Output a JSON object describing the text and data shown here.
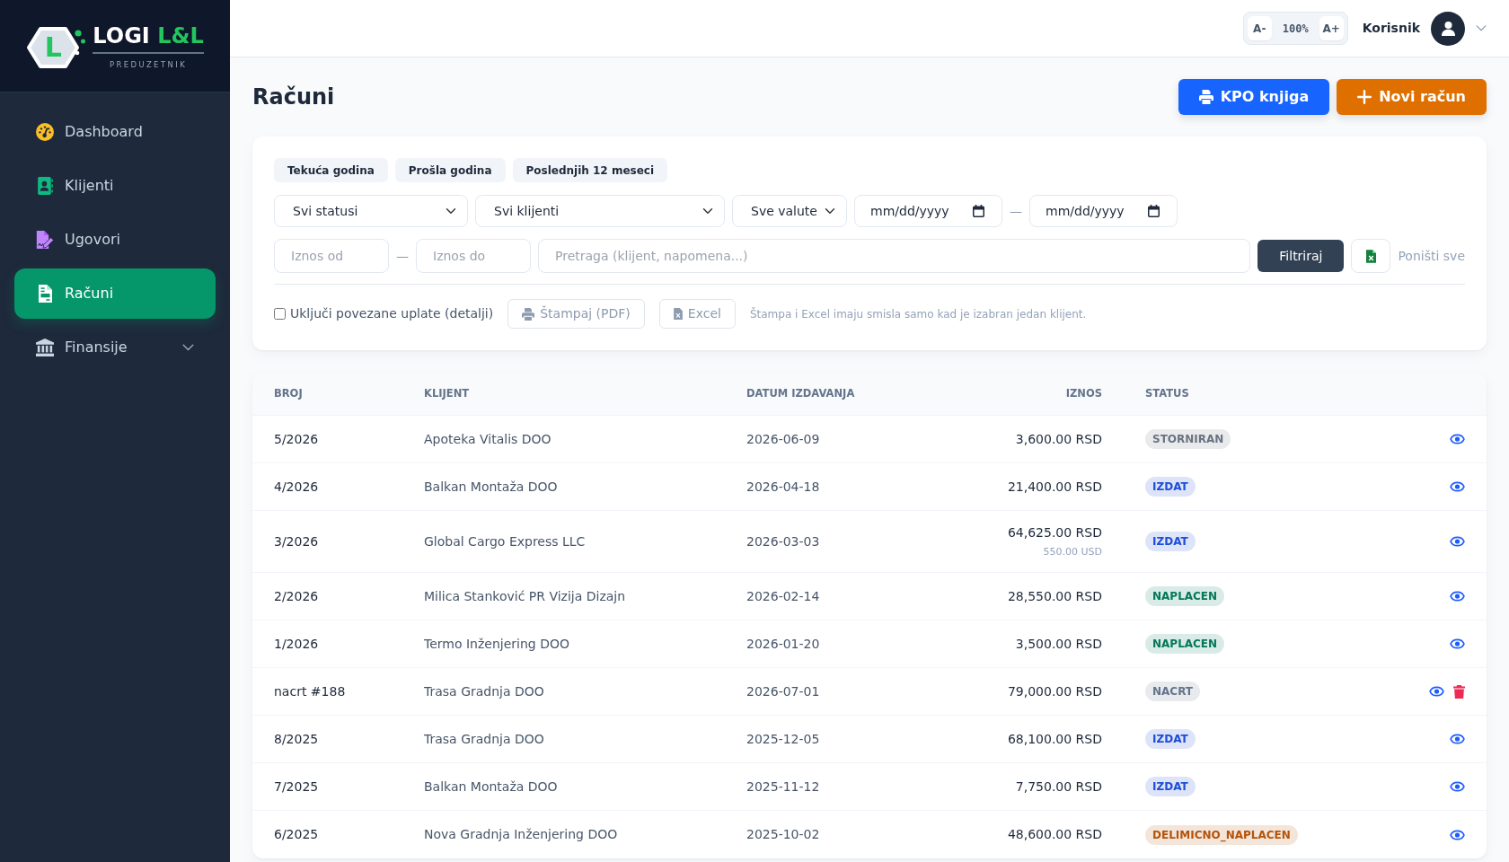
{
  "sidebar": {
    "logo": {
      "mark": "L",
      "title": "LOGI",
      "title_accent": "L&L",
      "tagline": "PREDUZETNIK"
    },
    "items": [
      {
        "label": "Dashboard",
        "kind": "link",
        "selected": false
      },
      {
        "label": "Klijenti",
        "kind": "link",
        "selected": false
      },
      {
        "label": "Ugovori",
        "kind": "link",
        "selected": false
      },
      {
        "label": "Računi",
        "kind": "link",
        "selected": true
      },
      {
        "label": "Finansije",
        "kind": "group",
        "selected": false
      }
    ]
  },
  "topbar": {
    "font_decrease": "A-",
    "zoom_level": "100%",
    "font_increase": "A+",
    "user_name": "Korisnik"
  },
  "page": {
    "title": "Računi",
    "actions": [
      {
        "label": "KPO knjiga",
        "kind": "print"
      },
      {
        "label": "Novi račun",
        "kind": "create"
      }
    ]
  },
  "filters": {
    "quick_ranges": [
      "Tekuća godina",
      "Prošla godina",
      "Poslednjih 12 meseci"
    ],
    "status": {
      "value": "Svi statusi"
    },
    "client": {
      "value": "Svi klijenti"
    },
    "currency": {
      "value": "Sve valute"
    },
    "date_from": {
      "placeholder": "mm/dd/yyyy"
    },
    "date_separator": "—",
    "date_to": {
      "placeholder": "mm/dd/yyyy"
    },
    "amount_from": {
      "placeholder": "Iznos od"
    },
    "amount_separator": "—",
    "amount_to": {
      "placeholder": "Iznos do"
    },
    "search": {
      "placeholder": "Pretraga (klijent, napomena...)"
    },
    "filter_button": "Filtriraj",
    "reset_link": "Poništi sve",
    "include_payments": {
      "label": "Uključi povezane uplate (detalji)",
      "checked": false
    },
    "print_button": {
      "label": "Štampaj (PDF)",
      "disabled": true
    },
    "excel_button": {
      "label": "Excel",
      "disabled": true
    },
    "note": "Štampa i Excel imaju smisla samo kad je izabran jedan klijent."
  },
  "table": {
    "columns": [
      {
        "label": "BROJ",
        "kind": "text"
      },
      {
        "label": "KLIJENT",
        "kind": "text"
      },
      {
        "label": "DATUM IZDAVANJA",
        "kind": "text"
      },
      {
        "label": "IZNOS",
        "kind": "amount"
      },
      {
        "label": "STATUS",
        "kind": "status"
      }
    ],
    "rows": [
      {
        "number": "5/2026",
        "client": "Apoteka Vitalis DOO",
        "date": "2026-06-09",
        "amount": "3,600.00 RSD",
        "status": {
          "label": "STORNIRAN",
          "color": "#6b7280"
        },
        "deletable": false
      },
      {
        "number": "4/2026",
        "client": "Balkan Montaža DOO",
        "date": "2026-04-18",
        "amount": "21,400.00 RSD",
        "status": {
          "label": "IZDAT",
          "color": "#1d4ed8"
        },
        "deletable": false
      },
      {
        "number": "3/2026",
        "client": "Global Cargo Express LLC",
        "date": "2026-03-03",
        "amount": "64,625.00 RSD",
        "amount_foreign": "550.00 USD",
        "status": {
          "label": "IZDAT",
          "color": "#1d4ed8"
        },
        "deletable": false
      },
      {
        "number": "2/2026",
        "client": "Milica Stanković PR Vizija Dizajn",
        "date": "2026-02-14",
        "amount": "28,550.00 RSD",
        "status": {
          "label": "NAPLACEN",
          "color": "#047857"
        },
        "deletable": false
      },
      {
        "number": "1/2026",
        "client": "Termo Inženjering DOO",
        "date": "2026-01-20",
        "amount": "3,500.00 RSD",
        "status": {
          "label": "NAPLACEN",
          "color": "#047857"
        },
        "deletable": false
      },
      {
        "number": "nacrt #188",
        "client": "Trasa Gradnja DOO",
        "date": "2026-07-01",
        "amount": "79,000.00 RSD",
        "status": {
          "label": "NACRT",
          "color": "#64748b"
        },
        "deletable": true
      },
      {
        "number": "8/2025",
        "client": "Trasa Gradnja DOO",
        "date": "2025-12-05",
        "amount": "68,100.00 RSD",
        "status": {
          "label": "IZDAT",
          "color": "#1d4ed8"
        },
        "deletable": false
      },
      {
        "number": "7/2025",
        "client": "Balkan Montaža DOO",
        "date": "2025-11-12",
        "amount": "7,750.00 RSD",
        "status": {
          "label": "IZDAT",
          "color": "#1d4ed8"
        },
        "deletable": false
      },
      {
        "number": "6/2025",
        "client": "Nova Gradnja Inženjering DOO",
        "date": "2025-10-02",
        "amount": "48,600.00 RSD",
        "status": {
          "label": "DELIMICNO_NAPLACEN",
          "color": "#b45309"
        },
        "deletable": false
      }
    ]
  }
}
